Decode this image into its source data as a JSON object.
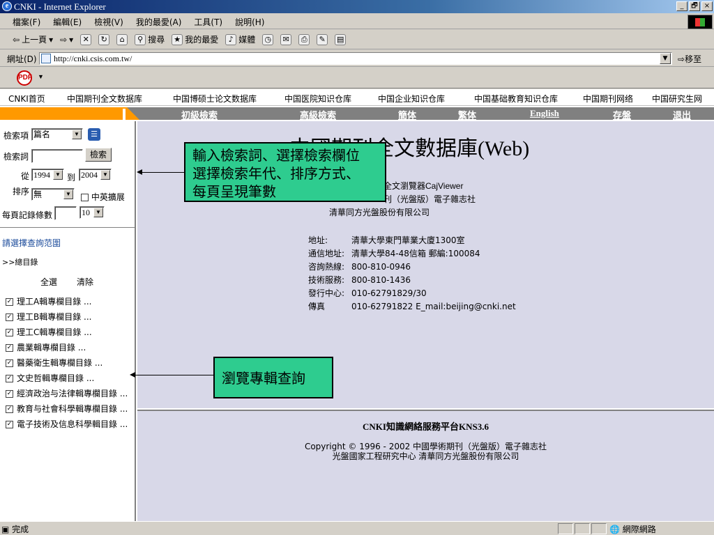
{
  "window": {
    "title": "CNKI - Internet Explorer",
    "controls": [
      "_",
      "🗗",
      "×"
    ]
  },
  "menu": [
    "檔案(F)",
    "編輯(E)",
    "檢視(V)",
    "我的最愛(A)",
    "工具(T)",
    "說明(H)"
  ],
  "toolbar": {
    "back": "上一頁",
    "search": "搜尋",
    "favorites": "我的最愛",
    "media": "媒體"
  },
  "address": {
    "label": "網址(D)",
    "url": "http://cnki.csis.com.tw/",
    "go": "移至"
  },
  "topnav": [
    "CNKI首页",
    "中国期刊全文数据库",
    "中国博硕士论文数据库",
    "中国医院知识仓库",
    "中国企业知识仓库",
    "中国基础教育知识仓库",
    "中国期刊网络",
    "中国研究生网"
  ],
  "subnav": [
    "初級檢索",
    "高級檢索",
    "簡体",
    "繁体",
    "English",
    "存盤",
    "退出"
  ],
  "form": {
    "field_label": "檢索項",
    "field_value": "篇名",
    "term_label": "檢索詞",
    "search_btn": "檢索",
    "from_label": "從",
    "from_year": "1994",
    "to_label": "到",
    "to_year": "2004",
    "sort_label": "排序",
    "sort_value": "無",
    "ext_label": "中英擴展",
    "per_page_label": "每頁記錄條數",
    "per_page_value": "10"
  },
  "scope": {
    "title": "請選擇查詢范圍",
    "root": ">>總目錄",
    "select_all": "全選",
    "clear": "清除",
    "items": [
      "理工A輯專欄目錄 ...",
      "理工B輯專欄目錄 ...",
      "理工C輯專欄目錄 ...",
      "農業輯專欄目錄 ...",
      "醫藥衛生輯專欄目錄 ...",
      "文史哲輯專欄目錄 ...",
      "經濟政治与法律輯專欄目錄 ...",
      "教育与社會科學輯專欄目錄 ...",
      "電子技術及信息科學輯目錄 ..."
    ]
  },
  "main": {
    "title": "中國期刊全文數据庫(Web)",
    "line1": "全文瀏覽器CajViewer",
    "line2": "刊（光盤版）電子雜志社",
    "line3": "清華同方光盤股份有限公司",
    "info": [
      {
        "k": "地址:",
        "v": "清華大學東門華業大廈1300室"
      },
      {
        "k": "通信地址:",
        "v": "清華大學84-48信箱 郵編:100084"
      },
      {
        "k": "咨詢熱線:",
        "v": "800-810-0946"
      },
      {
        "k": "技術服務:",
        "v": "800-810-1436"
      },
      {
        "k": "發行中心:",
        "v": "010-62791829/30"
      },
      {
        "k": "傳真",
        "v": "010-62791822 E_mail:beijing@cnki.net"
      }
    ]
  },
  "footer": {
    "kns": "CNKI知識網絡服務平台KNS3.6",
    "copy1": "Copyright © 1996 - 2002  中國學術期刊（光盤版）電子雜志社",
    "copy2": "光盤國家工程研究中心  清華同方光盤股份有限公司"
  },
  "callouts": {
    "c1": [
      "輸入檢索詞、選擇檢索欄位",
      "選擇檢索年代、排序方式、",
      "每頁呈現筆數"
    ],
    "c2": "瀏覽專輯查詢"
  },
  "status": {
    "text": "完成",
    "zone": "網際網路"
  },
  "colors": {
    "orange": "#ff9900",
    "nav_gray": "#808080",
    "callout": "#2ecc8f",
    "main_bg": "#d8d8e8"
  }
}
